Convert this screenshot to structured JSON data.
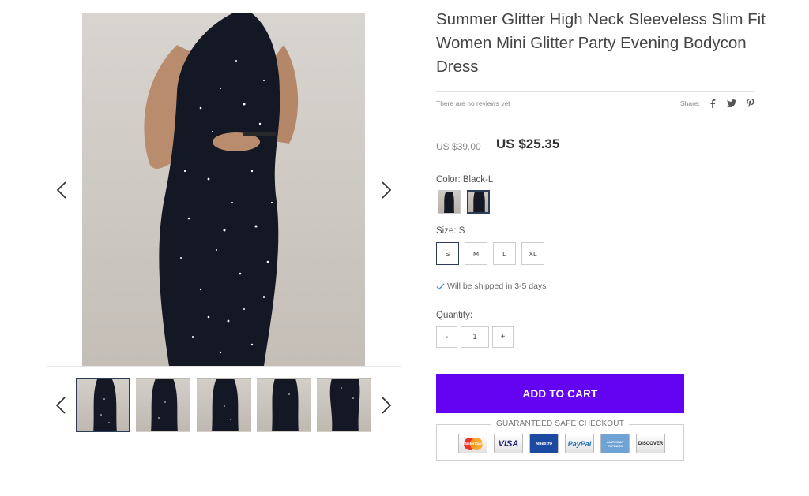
{
  "product": {
    "title": "Summer Glitter High Neck Sleeveless Slim Fit Women Mini Glitter Party Evening Bodycon Dress",
    "reviews_text": "There are no reviews yet",
    "share_label": "Share:",
    "share_icons": [
      "facebook-icon",
      "twitter-icon",
      "pinterest-icon"
    ],
    "old_price": "US $39.00",
    "price": "US $25.35"
  },
  "options": {
    "color_label": "Color: Black-L",
    "size_label": "Size: S",
    "sizes": [
      "S",
      "M",
      "L",
      "XL"
    ],
    "selected_size": "S",
    "colors_selected_index": 1
  },
  "shipping": {
    "text": "Will be shipped in 3-5 days"
  },
  "quantity": {
    "label": "Quantity:",
    "minus": "-",
    "value": "1",
    "plus": "+"
  },
  "cart": {
    "add_label": "ADD TO CART",
    "accent": "#6303f1"
  },
  "checkout": {
    "label": "GUARANTEED SAFE CHECKOUT",
    "cards": [
      {
        "name": "MasterCard",
        "text": "MasterCard"
      },
      {
        "name": "visa",
        "text": "VISA"
      },
      {
        "name": "maestro",
        "text": "Maestro"
      },
      {
        "name": "paypal",
        "text": "PayPal"
      },
      {
        "name": "american-express",
        "text": "AMERICAN EXPRESS"
      },
      {
        "name": "discover",
        "text": "DISCOVER"
      }
    ]
  },
  "gallery": {
    "thumbnail_count": 5,
    "active_thumbnail": 0
  },
  "colors": {
    "border_active": "#2c3e57",
    "dress": "#121521"
  }
}
